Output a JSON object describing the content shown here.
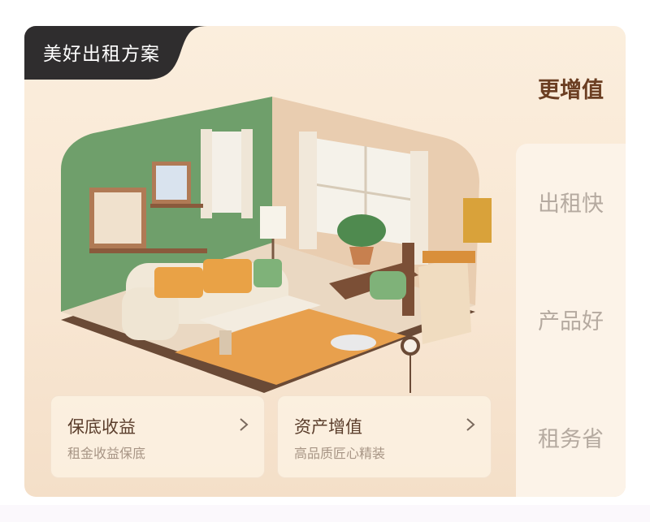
{
  "badge": {
    "label": "美好出租方案"
  },
  "tabs": {
    "active": "更增值",
    "items": [
      "出租快",
      "产品好",
      "租务省"
    ]
  },
  "cards": [
    {
      "title": "保底收益",
      "subtitle": "租金收益保底"
    },
    {
      "title": "资产增值",
      "subtitle": "高品质匠心精装"
    }
  ],
  "colors": {
    "badge_bg": "#2f2d2e",
    "active_tab": "#6b3e22",
    "inactive_tab": "#b5aaa0",
    "card_bg": "#fbeedd",
    "wall_green": "#6f9f6b"
  },
  "icons": {
    "card_arrow": "chevron-right-icon"
  }
}
